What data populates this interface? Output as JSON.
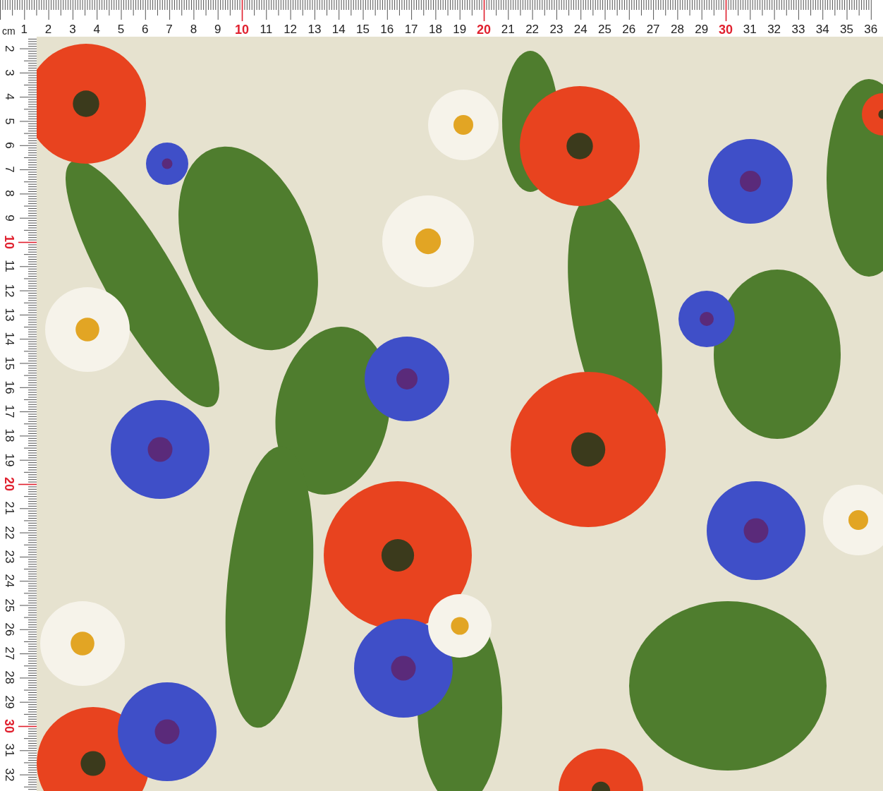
{
  "top_ruler": {
    "unit": "cm",
    "labels": [
      {
        "text": "1",
        "highlighted": false
      },
      {
        "text": "2",
        "highlighted": false
      },
      {
        "text": "3",
        "highlighted": false
      },
      {
        "text": "4",
        "highlighted": false
      },
      {
        "text": "5",
        "highlighted": false
      },
      {
        "text": "6",
        "highlighted": false
      },
      {
        "text": "7",
        "highlighted": false
      },
      {
        "text": "8",
        "highlighted": false
      },
      {
        "text": "9",
        "highlighted": false
      },
      {
        "text": "10",
        "highlighted": true
      },
      {
        "text": "11",
        "highlighted": false
      },
      {
        "text": "12",
        "highlighted": false
      },
      {
        "text": "13",
        "highlighted": false
      },
      {
        "text": "14",
        "highlighted": false
      },
      {
        "text": "15",
        "highlighted": false
      },
      {
        "text": "16",
        "highlighted": false
      },
      {
        "text": "17",
        "highlighted": false
      },
      {
        "text": "18",
        "highlighted": false
      },
      {
        "text": "19",
        "highlighted": false
      },
      {
        "text": "20",
        "highlighted": true
      },
      {
        "text": "21",
        "highlighted": false
      },
      {
        "text": "22",
        "highlighted": false
      },
      {
        "text": "23",
        "highlighted": false
      },
      {
        "text": "24",
        "highlighted": false
      },
      {
        "text": "25",
        "highlighted": false
      },
      {
        "text": "26",
        "highlighted": false
      },
      {
        "text": "27",
        "highlighted": false
      },
      {
        "text": "28",
        "highlighted": false
      },
      {
        "text": "29",
        "highlighted": false
      },
      {
        "text": "30",
        "highlighted": true
      },
      {
        "text": "31",
        "highlighted": false
      },
      {
        "text": "32",
        "highlighted": false
      },
      {
        "text": "33",
        "highlighted": false
      },
      {
        "text": "34",
        "highlighted": false
      },
      {
        "text": "35",
        "highlighted": false
      },
      {
        "text": "36",
        "highlighted": false
      }
    ]
  },
  "left_ruler": {
    "labels": [
      {
        "text": "2",
        "highlighted": false
      },
      {
        "text": "3",
        "highlighted": false
      },
      {
        "text": "4",
        "highlighted": false
      },
      {
        "text": "5",
        "highlighted": false
      },
      {
        "text": "6",
        "highlighted": false
      },
      {
        "text": "7",
        "highlighted": false
      },
      {
        "text": "8",
        "highlighted": false
      },
      {
        "text": "9",
        "highlighted": false
      },
      {
        "text": "10",
        "highlighted": true
      },
      {
        "text": "11",
        "highlighted": false
      },
      {
        "text": "12",
        "highlighted": false
      },
      {
        "text": "13",
        "highlighted": false
      },
      {
        "text": "14",
        "highlighted": false
      },
      {
        "text": "15",
        "highlighted": false
      },
      {
        "text": "16",
        "highlighted": false
      },
      {
        "text": "17",
        "highlighted": false
      },
      {
        "text": "18",
        "highlighted": false
      },
      {
        "text": "19",
        "highlighted": false
      },
      {
        "text": "20",
        "highlighted": true
      },
      {
        "text": "21",
        "highlighted": false
      },
      {
        "text": "22",
        "highlighted": false
      },
      {
        "text": "23",
        "highlighted": false
      },
      {
        "text": "24",
        "highlighted": false
      },
      {
        "text": "25",
        "highlighted": false
      },
      {
        "text": "26",
        "highlighted": false
      },
      {
        "text": "27",
        "highlighted": false
      },
      {
        "text": "28",
        "highlighted": false
      },
      {
        "text": "29",
        "highlighted": false
      },
      {
        "text": "30",
        "highlighted": true
      },
      {
        "text": "31",
        "highlighted": false
      },
      {
        "text": "32",
        "highlighted": false
      }
    ]
  }
}
